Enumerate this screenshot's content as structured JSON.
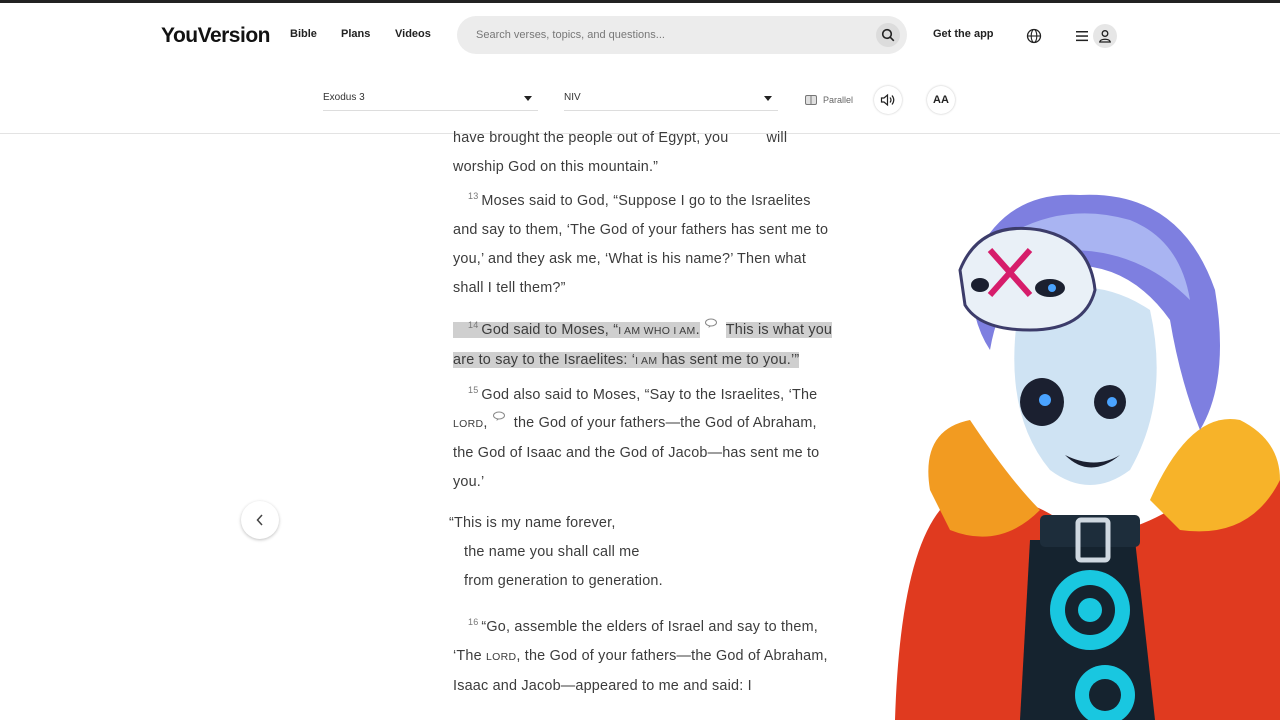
{
  "header": {
    "logo": "YouVersion",
    "nav": [
      "Bible",
      "Plans",
      "Videos"
    ],
    "search_placeholder": "Search verses, topics, and questions...",
    "get_app": "Get the app"
  },
  "toolbar": {
    "book": "Exodus 3",
    "version": "NIV",
    "parallel": "Parallel",
    "font_button": "AA"
  },
  "reader": {
    "intro_1": "have brought the people out of Egypt, you",
    "intro_2": "will",
    "intro_3": "worship God on this mountain.”",
    "v13_num": "13",
    "v13": "Moses said to God, “Suppose I go to the Israelites and say to them, ‘The God of your fathers has sent me to you,’ and they ask me, ‘What is his name?’ Then what shall I tell them?”",
    "v14_num": "14",
    "v14_a": "God said to Moses, “",
    "v14_iam": "I am who I am",
    "v14_b": ".",
    "v14_c": "This is what you are to say to the Israelites: ‘",
    "v14_iam2": "I am",
    "v14_d": " has sent me to you.’”",
    "v15_num": "15",
    "v15_a": "God also said to Moses, “Say to the Israelites, ‘The ",
    "v15_lord": "Lord",
    "v15_b": ",",
    "v15_c": "the God of your fathers—the God of Abraham, the God of Isaac and the God of Jacob—has sent me to you.’",
    "poem_1": "“This is my name forever,",
    "poem_2": "the name you shall call me",
    "poem_3": "from generation to generation.",
    "v16_num": "16",
    "v16_a": "“Go, assemble the elders of Israel and say to them, ‘The ",
    "v16_lord": "Lord",
    "v16_b": ", the God of your fathers—the God of Abraham, Isaac and Jacob—appeared to me and said: I"
  },
  "colors": {
    "highlight": "#cfcfcf",
    "text": "#3c3c3c"
  }
}
